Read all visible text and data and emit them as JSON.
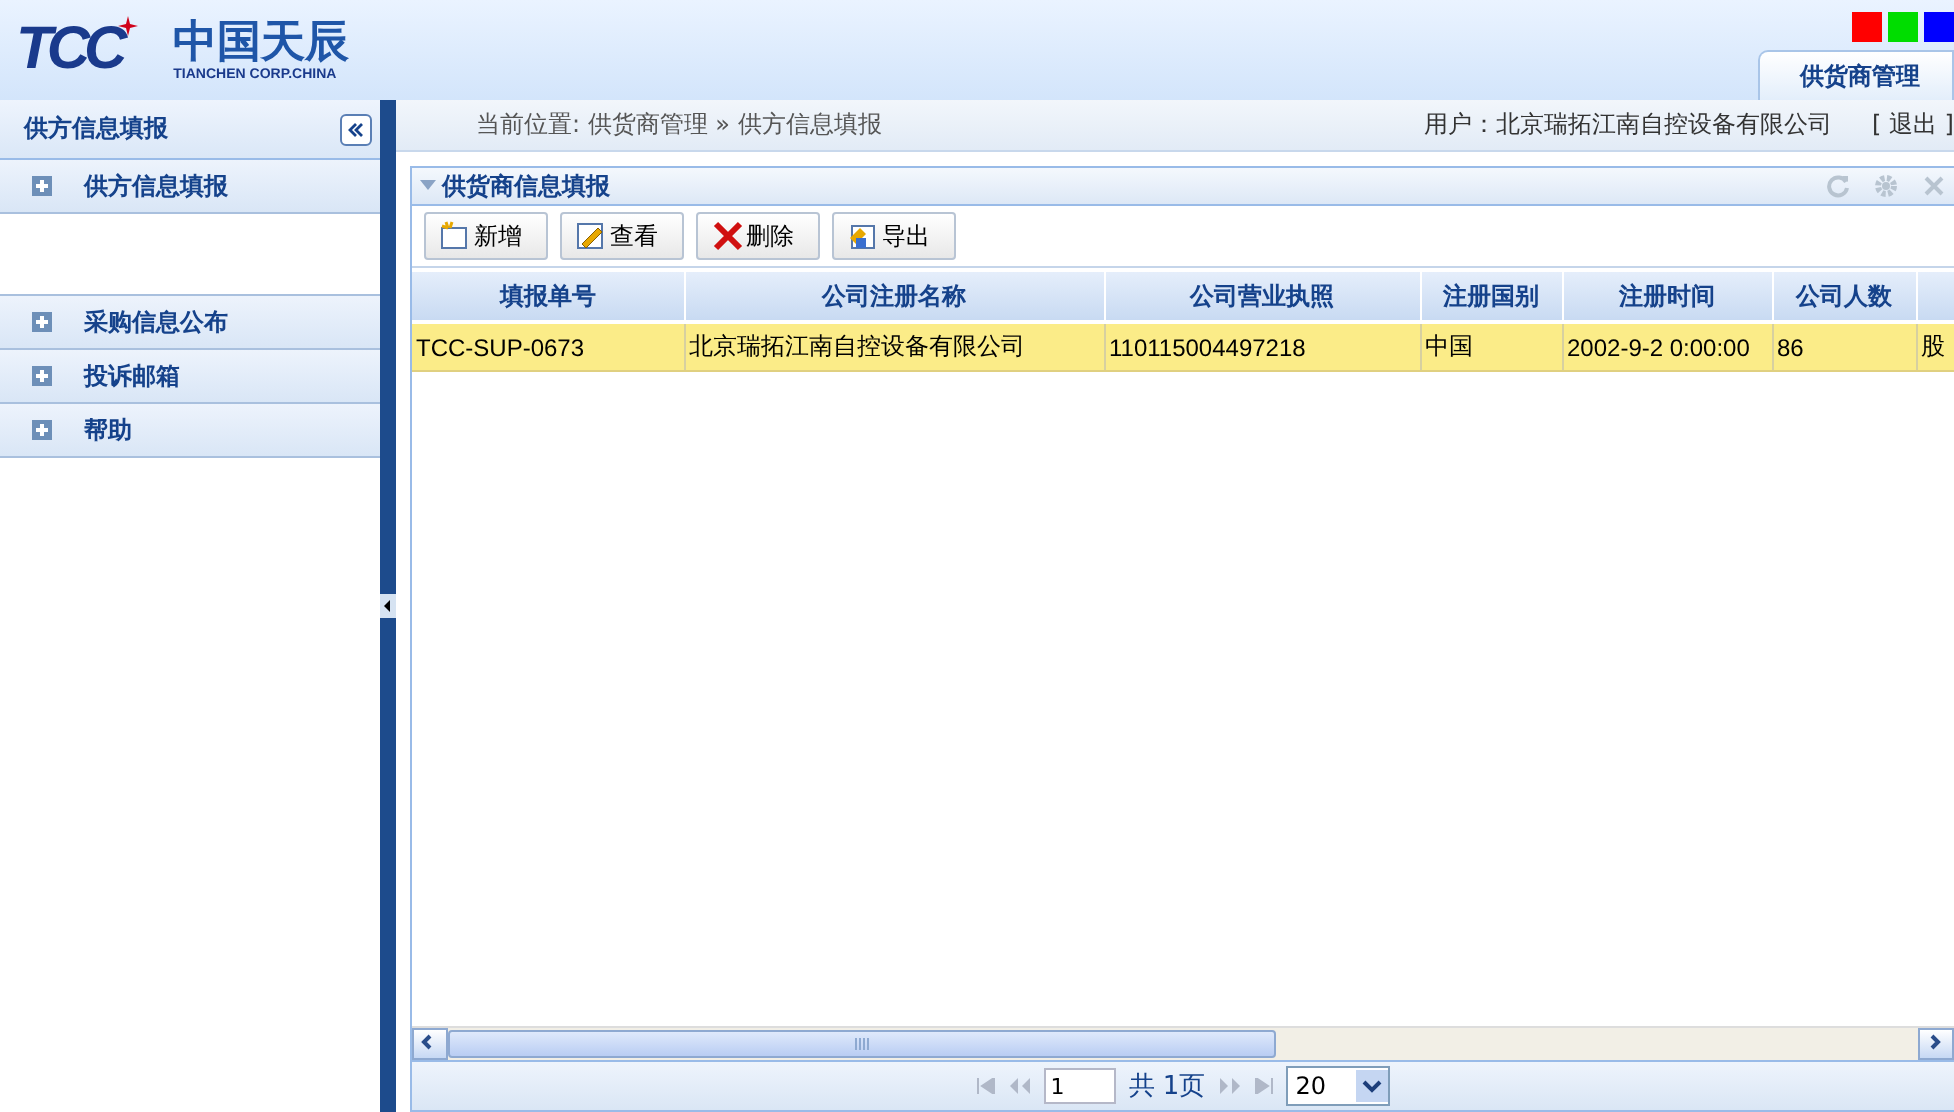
{
  "header": {
    "logo_mark": "TCC",
    "logo_name": "中国天辰",
    "logo_subtitle": "TIANCHEN CORP.CHINA",
    "theme_swatches": [
      {
        "color": "#ff0000"
      },
      {
        "color": "#00dd00"
      },
      {
        "color": "#0000ff"
      }
    ],
    "tabs": [
      {
        "label": "供货商管理",
        "selected": true
      }
    ]
  },
  "sidebar": {
    "title": "供方信息填报",
    "sections": [
      {
        "label": "供方信息填报",
        "expanded": true
      },
      {
        "label": "采购信息公布",
        "expanded": false
      },
      {
        "label": "投诉邮箱",
        "expanded": false
      },
      {
        "label": "帮助",
        "expanded": false
      }
    ]
  },
  "breadcrumb": "当前位置: 供货商管理 » 供方信息填报",
  "user": "用户：北京瑞拓江南自控设备有限公司",
  "logout": "[ 退出 ]",
  "panel": {
    "title": "供货商信息填报",
    "toolbar": [
      {
        "label": "新增",
        "kind": "add"
      },
      {
        "label": "查看",
        "kind": "view"
      },
      {
        "label": "删除",
        "kind": "delete"
      },
      {
        "label": "导出",
        "kind": "export"
      }
    ],
    "table": {
      "columns": [
        "填报单号",
        "公司注册名称",
        "公司营业执照",
        "注册国别",
        "注册时间",
        "公司人数"
      ],
      "rows": [
        {
          "selected": true,
          "cells": [
            "TCC-SUP-0673",
            "北京瑞拓江南自控设备有限公司",
            "110115004497218",
            "中国",
            "2002-9-2 0:00:00",
            "86",
            "股"
          ]
        }
      ]
    },
    "pager": {
      "page": "1",
      "total": "共 1页",
      "page_size": "20"
    }
  }
}
